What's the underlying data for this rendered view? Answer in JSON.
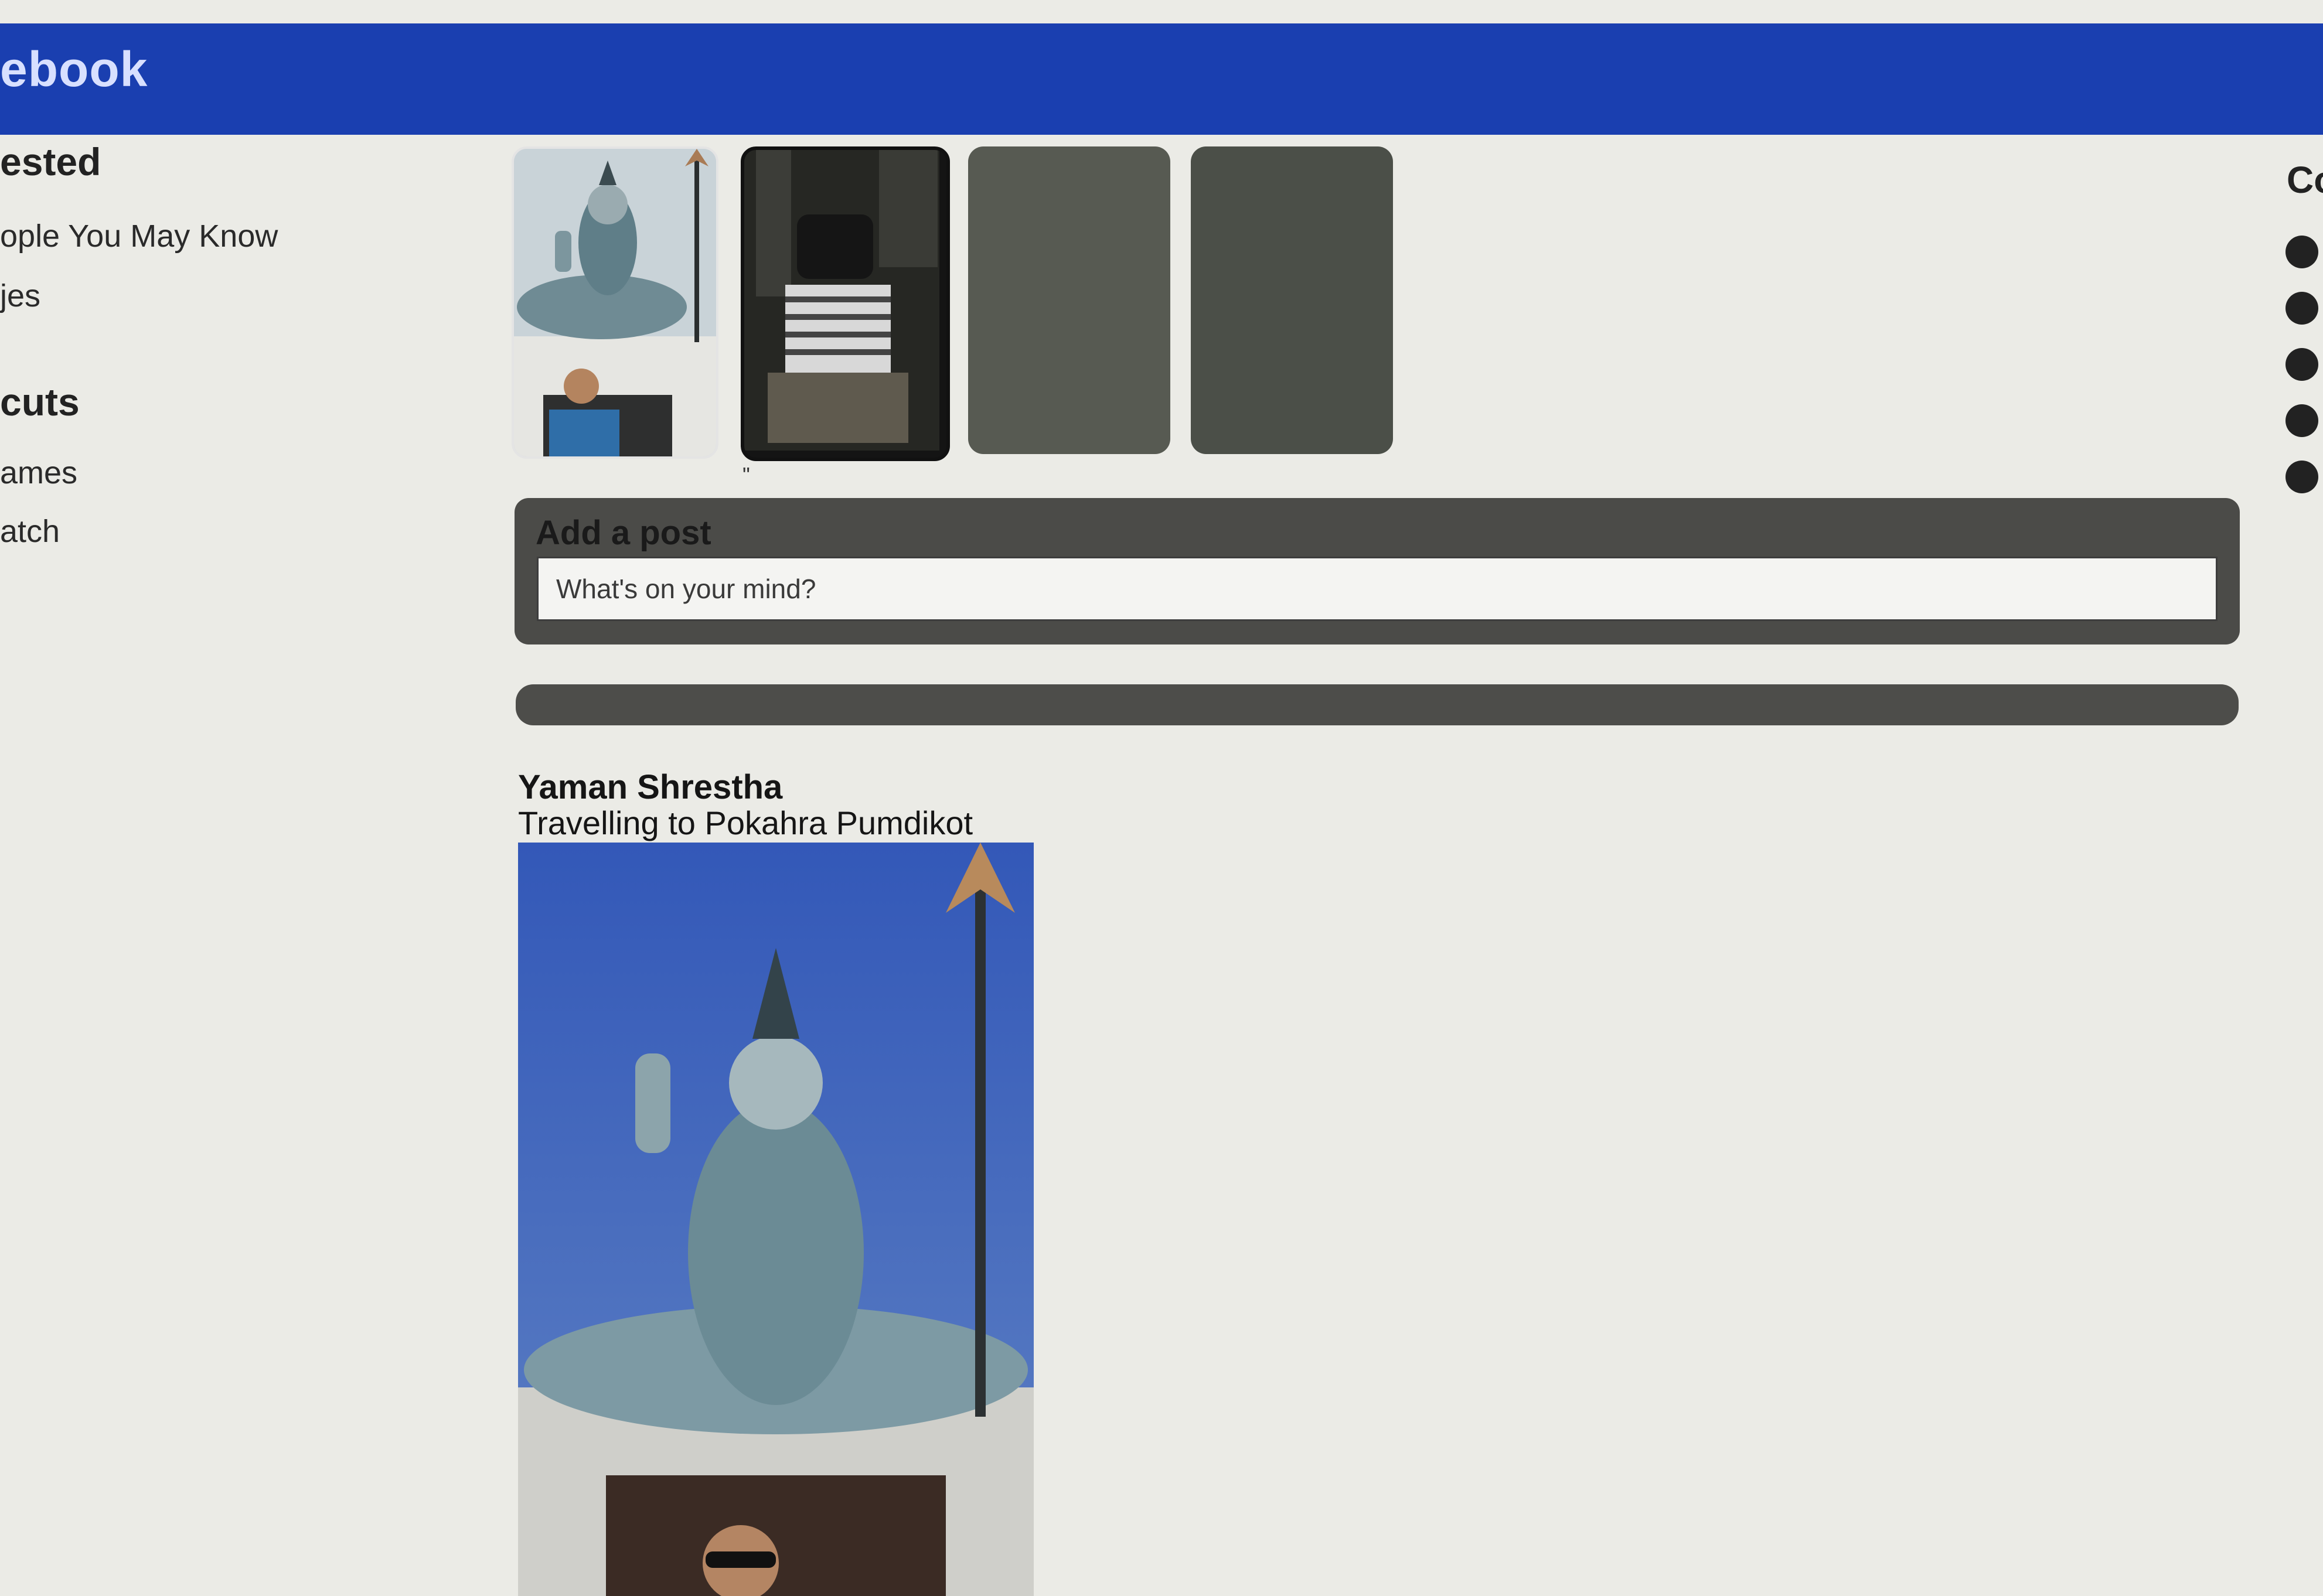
{
  "app": {
    "brand": "ebook"
  },
  "left_sidebar": {
    "section1_heading": "ested",
    "section1_items": [
      "ople You May Know",
      "jes"
    ],
    "section2_heading": "cuts",
    "section2_items": [
      "ames",
      "atch"
    ]
  },
  "stories": {
    "caption": "\""
  },
  "composer": {
    "title": "Add a post",
    "placeholder": "What's on your mind?"
  },
  "feed": {
    "post": {
      "author": "Yaman Shrestha",
      "text": "Travelling to Pokahra Pumdikot"
    }
  },
  "right_sidebar": {
    "heading": "Co"
  },
  "colors": {
    "topbar": "#1a3fb0",
    "panel": "#4b4b48"
  },
  "icons": {
    "contact_status": "filled-circle"
  }
}
